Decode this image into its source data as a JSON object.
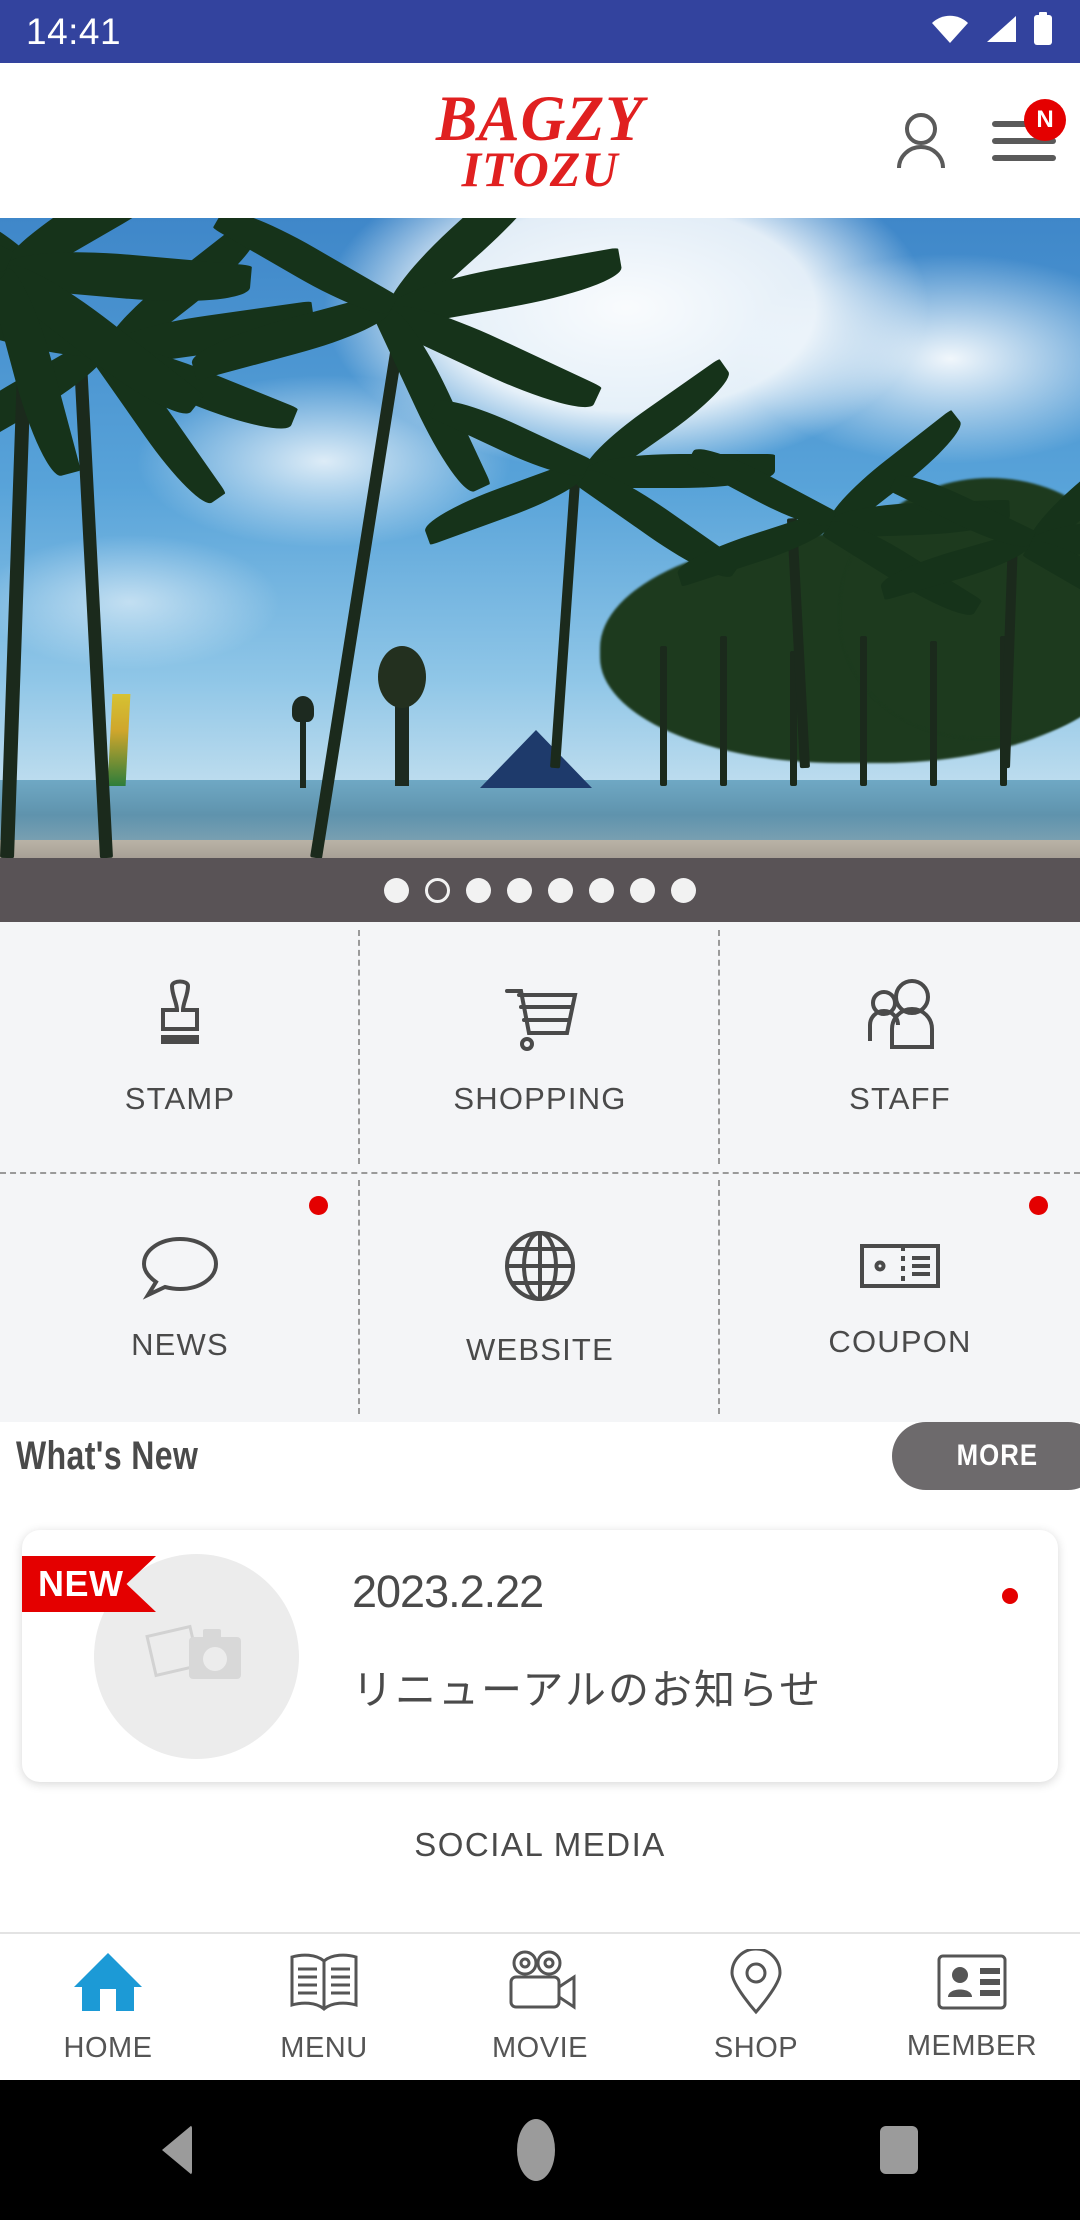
{
  "statusbar": {
    "time": "14:41",
    "icons": [
      "wifi-icon",
      "signal-icon",
      "battery-icon"
    ],
    "background": "#33439e"
  },
  "header": {
    "logo_line1": "BAGZY",
    "logo_line2": "ITOZU",
    "logo_color": "#e02020",
    "account_icon": "person-icon",
    "menu_icon": "hamburger-menu-icon",
    "menu_badge": "N",
    "badge_color": "#e40000"
  },
  "hero": {
    "alt": "palm-trees-beach-photo",
    "carousel": {
      "total": 8,
      "active_index": 2,
      "bar_color": "#595356"
    }
  },
  "grid": {
    "items": [
      {
        "label": "STAMP",
        "icon": "stamp-icon",
        "badge": false
      },
      {
        "label": "SHOPPING",
        "icon": "shopping-cart-icon",
        "badge": false
      },
      {
        "label": "STAFF",
        "icon": "people-icon",
        "badge": false
      },
      {
        "label": "NEWS",
        "icon": "speech-bubble-icon",
        "badge": true
      },
      {
        "label": "WEBSITE",
        "icon": "globe-icon",
        "badge": false
      },
      {
        "label": "COUPON",
        "icon": "ticket-icon",
        "badge": true
      }
    ],
    "badge_color": "#e40000"
  },
  "whats_new": {
    "title": "What's New",
    "more_label": "MORE",
    "more_color": "#6d6a6c"
  },
  "news": {
    "items": [
      {
        "ribbon": "NEW",
        "date": "2023.2.22",
        "title": "リニューアルのお知らせ",
        "thumb_icon": "photo-placeholder-icon",
        "unread": true
      }
    ]
  },
  "social": {
    "label": "SOCIAL MEDIA"
  },
  "bottom_nav": {
    "active": "HOME",
    "active_color": "#1c9ad6",
    "items": [
      {
        "label": "HOME",
        "icon": "home-icon"
      },
      {
        "label": "MENU",
        "icon": "book-icon"
      },
      {
        "label": "MOVIE",
        "icon": "video-camera-icon"
      },
      {
        "label": "SHOP",
        "icon": "map-pin-icon"
      },
      {
        "label": "MEMBER",
        "icon": "id-card-icon"
      }
    ]
  },
  "android_nav": {
    "back": "back-triangle-icon",
    "home": "home-circle-icon",
    "recents": "recents-square-icon"
  }
}
